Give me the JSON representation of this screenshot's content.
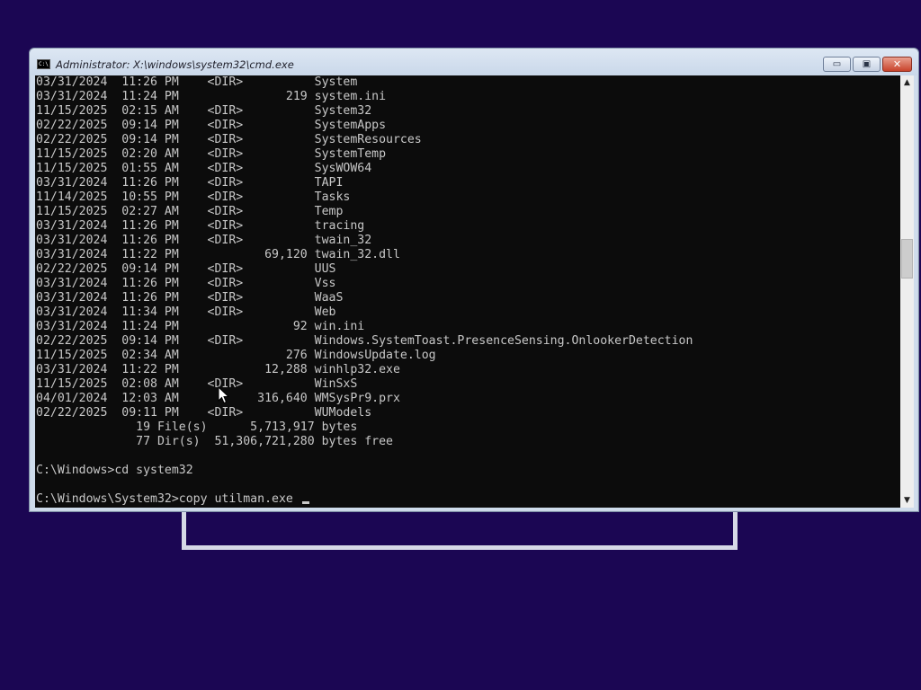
{
  "window": {
    "title": "Administrator: X:\\windows\\system32\\cmd.exe",
    "icon_text": "C:\\",
    "minimize_glyph": "▭",
    "maximize_glyph": "▣",
    "close_glyph": "✕"
  },
  "scrollbar": {
    "up_glyph": "▲",
    "down_glyph": "▼"
  },
  "console": {
    "lines": [
      "03/31/2024  11:26 PM    <DIR>          System",
      "03/31/2024  11:24 PM               219 system.ini",
      "11/15/2025  02:15 AM    <DIR>          System32",
      "02/22/2025  09:14 PM    <DIR>          SystemApps",
      "02/22/2025  09:14 PM    <DIR>          SystemResources",
      "11/15/2025  02:20 AM    <DIR>          SystemTemp",
      "11/15/2025  01:55 AM    <DIR>          SysWOW64",
      "03/31/2024  11:26 PM    <DIR>          TAPI",
      "11/14/2025  10:55 PM    <DIR>          Tasks",
      "11/15/2025  02:27 AM    <DIR>          Temp",
      "03/31/2024  11:26 PM    <DIR>          tracing",
      "03/31/2024  11:26 PM    <DIR>          twain_32",
      "03/31/2024  11:22 PM            69,120 twain_32.dll",
      "02/22/2025  09:14 PM    <DIR>          UUS",
      "03/31/2024  11:26 PM    <DIR>          Vss",
      "03/31/2024  11:26 PM    <DIR>          WaaS",
      "03/31/2024  11:34 PM    <DIR>          Web",
      "03/31/2024  11:24 PM                92 win.ini",
      "02/22/2025  09:14 PM    <DIR>          Windows.SystemToast.PresenceSensing.OnlookerDetection",
      "11/15/2025  02:34 AM               276 WindowsUpdate.log",
      "03/31/2024  11:22 PM            12,288 winhlp32.exe",
      "11/15/2025  02:08 AM    <DIR>          WinSxS",
      "04/01/2024  12:03 AM           316,640 WMSysPr9.prx",
      "02/22/2025  09:11 PM    <DIR>          WUModels",
      "              19 File(s)      5,713,917 bytes",
      "              77 Dir(s)  51,306,721,280 bytes free",
      "",
      "C:\\Windows>cd system32",
      ""
    ],
    "prompt_line": "C:\\Windows\\System32>copy utilman.exe "
  }
}
